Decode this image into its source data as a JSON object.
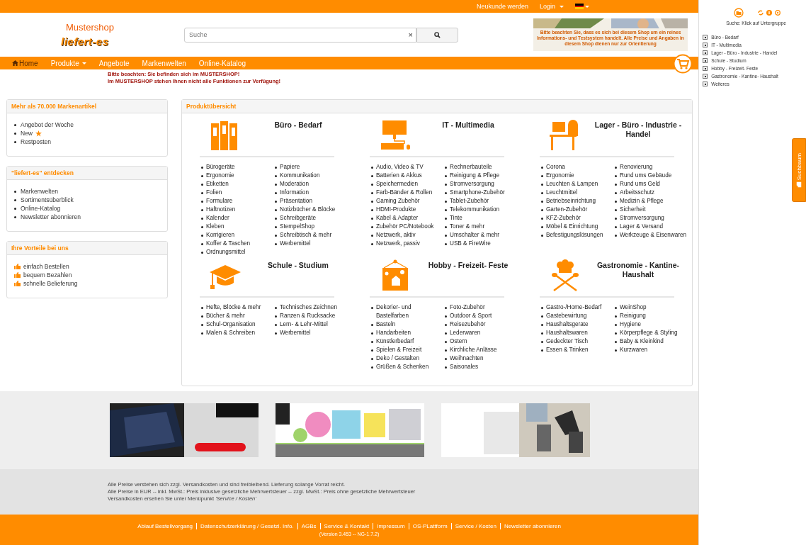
{
  "top_bar": {
    "links": [
      {
        "label": "Neukunde werden",
        "kind": "link"
      },
      {
        "label": "Login",
        "kind": "menu"
      }
    ]
  },
  "logo": {
    "line1": "Mustershop",
    "line2": "liefert-es"
  },
  "search": {
    "placeholder": "Suche",
    "clear": "×"
  },
  "notice_banner": {
    "text": "Bitte beachten Sie, dass es sich bei diesem Shop um ein reines Informations- und Testsystem handelt. Alle Preise und Angaben in diesem Shop dienen nur zur Orientierung"
  },
  "nav": [
    {
      "label": "Home",
      "selected": true,
      "kind": "home"
    },
    {
      "label": "Produkte",
      "selected": false,
      "kind": "menu"
    },
    {
      "label": "Angebote",
      "selected": false,
      "kind": "link"
    },
    {
      "label": "Markenwelten",
      "selected": false,
      "kind": "link"
    },
    {
      "label": "Online-Katalog",
      "selected": false,
      "kind": "link"
    }
  ],
  "warning": [
    "Bitte beachten: Sie befinden sich im MUSTERSHOP!",
    "Im MUSTERSHOP stehen Ihnen nicht alle Funktionen zur Verfügung!"
  ],
  "sidebar": [
    {
      "title": "Mehr als 70.000 Markenartikel",
      "kind": "bullet",
      "items": [
        {
          "label": "Angebot der Woche",
          "starred": false
        },
        {
          "label": "New",
          "starred": true
        },
        {
          "label": "Restposten",
          "starred": false
        }
      ]
    },
    {
      "title": "\"liefert-es\" entdecken",
      "kind": "bullet",
      "items": [
        {
          "label": "Markenwelten"
        },
        {
          "label": "Sortimentsüberblick"
        },
        {
          "label": "Online-Katalog"
        },
        {
          "label": "Newsletter abonnieren"
        }
      ]
    },
    {
      "title": "Ihre Vorteile bei uns",
      "kind": "thumb",
      "items": [
        {
          "label": "einfach Bestellen"
        },
        {
          "label": "bequem Bezahlen"
        },
        {
          "label": "schnelle Belieferung"
        }
      ]
    }
  ],
  "products": {
    "title": "Produktübersicht",
    "categories": [
      {
        "title": "Büro - Bedarf",
        "kind": "binders",
        "columns": [
          [
            "Bürogeräte",
            "Ergonomie",
            "Etiketten",
            "Folien",
            "Formulare",
            "Haftnotizen",
            "Kalender",
            "Kleben",
            "Korrigieren",
            "Koffer & Taschen",
            "Ordnungsmittel"
          ],
          [
            "Papiere",
            "Kommunikation",
            "Moderation",
            "Information",
            "Präsentation",
            "Notizbücher & Blöcke",
            "Schreibgeräte",
            "StempelShop",
            "Schreibtisch & mehr",
            "Werbemittel"
          ]
        ]
      },
      {
        "title": "IT - Multimedia",
        "kind": "computer",
        "columns": [
          [
            "Audio, Video & TV",
            "Batterien & Akkus",
            "Speichermedien",
            "Farb-Bänder & Rollen",
            "Gaming Zubehör",
            "HDMI-Produkte",
            "Kabel & Adapter",
            "Zubehör PC/Notebook",
            "Netzwerk, aktiv",
            "Netzwerk, passiv"
          ],
          [
            "Rechnerbauteile",
            "Reinigung & Pflege",
            "Stromversorgung",
            "Smartphone-Zubehör",
            "Tablet-Zubehör",
            "Telekommunikation",
            "Tinte",
            "Toner & mehr",
            "Umschalter & mehr",
            "USB & FireWire"
          ]
        ]
      },
      {
        "title": "Lager - Büro - Industrie - Handel",
        "kind": "desk",
        "columns": [
          [
            "Corona",
            "Ergonomie",
            "Leuchten & Lampen",
            "Leuchtmittel",
            "Betriebseinrichtung",
            "Garten-Zubehör",
            "KFZ-Zubehör",
            "Möbel & Einrichtung",
            "Befestigungslösungen"
          ],
          [
            "Renovierung",
            "Rund ums Gebäude",
            "Rund ums Geld",
            "Arbeitsschutz",
            "Medizin & Pflege",
            "Sicherheit",
            "Stromversorgung",
            "Lager & Versand",
            "Werkzeuge & Eisenwaren"
          ]
        ]
      },
      {
        "title": "Schule - Studium",
        "kind": "cap",
        "columns": [
          [
            "Hefte, Blöcke & mehr",
            "Bücher & mehr",
            "Schul-Organisation",
            "Malen & Schreiben"
          ],
          [
            "Technisches Zeichnen",
            "Ranzen & Rucksacke",
            "Lern- & Lehr-Mittel",
            "Werbemittel"
          ]
        ]
      },
      {
        "title": "Hobby - Freizeit- Feste",
        "kind": "frame",
        "columns": [
          [
            "Dekorier- und Bastelfarben",
            "Basteln",
            "Handarbeiten",
            "Künstlerbedarf",
            "Spielen & Freizeit",
            "Deko / Gestalten",
            "Grüßen & Schenken"
          ],
          [
            "Foto-Zubehör",
            "Outdoor & Sport",
            "Reisezubehör",
            "Lederwaren",
            "Ostern",
            "Kirchliche Anlässe",
            "Weihnachten",
            "Saisonales"
          ]
        ]
      },
      {
        "title": "Gastronomie - Kantine- Haushalt",
        "kind": "chef",
        "columns": [
          [
            "Gastro-/Home-Bedarf",
            "Gastebewirtung",
            "Haushaltsgerate",
            "Haushaltswaren",
            "Gedeckter Tisch",
            "Essen & Trinken"
          ],
          [
            "WeinShop",
            "Reinigung",
            "Hygiene",
            "Körperpflege & Styling",
            "Baby & Kleinkind",
            "Kurzwaren"
          ]
        ]
      }
    ]
  },
  "banners": [
    {
      "kind": "picture"
    },
    {
      "kind": "picture"
    },
    {
      "kind": "picture"
    }
  ],
  "footer_notes": [
    "Alle Preise verstehen sich zzgl. Versandkosten und sind freibleibend. Lieferung solange Vorrat reicht.",
    "Alle Preise in EUR -- inkl. MwSt.: Preis inklusive gesetzliche Mehrwertsteuer -- zzgl. MwSt.: Preis ohne gesetzliche Mehrwertsteuer",
    "Versandkosten ersehen Sie unter Menüpunkt *'Service / Kosten'*"
  ],
  "footer_links": [
    "Ablauf Bestellvorgang",
    "Datenschutzerklärung / Gesetzl. Info.",
    "AGBs",
    "Service & Kontakt",
    "Impressum",
    "OS-PLattform",
    "Service / Kosten",
    "Newsletter abonnieren"
  ],
  "version": "(Version 3.453 -- NG-1.7.2)",
  "search_tree": {
    "hint": "Suche: Klick auf Untergruppe",
    "items": [
      "Büro - Bedarf",
      "IT - Multimedia",
      "Lager - Büro - Industrie - Handel",
      "Schule - Studium",
      "Hobby - Freizeit- Feste",
      "Gastronomie - Kantine- Haushalt",
      "Weiteres"
    ],
    "tab": "Suchbaum"
  }
}
